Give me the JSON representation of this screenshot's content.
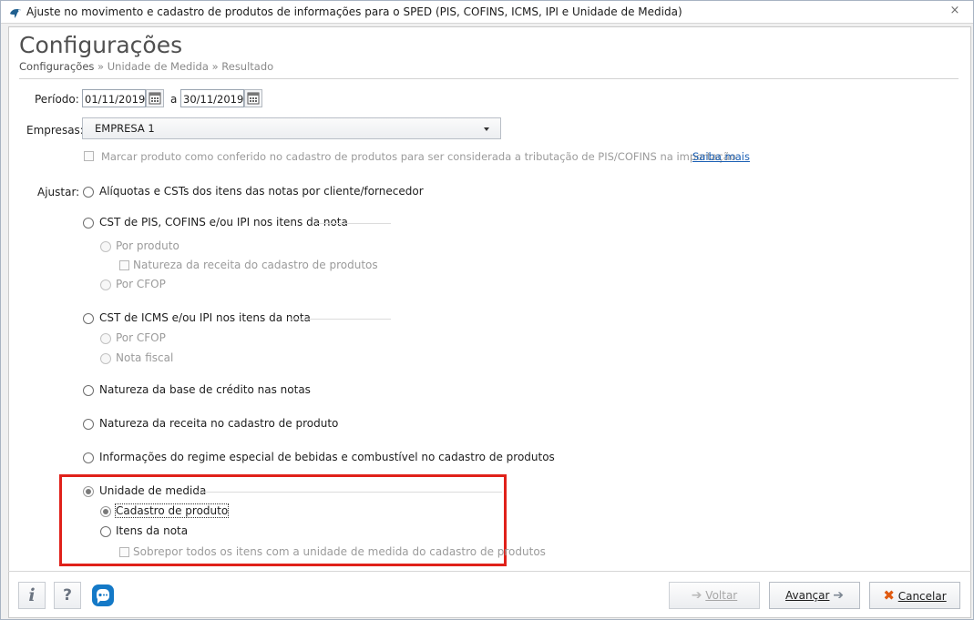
{
  "window": {
    "title": "Ajuste no movimento e cadastro de produtos de informações para o SPED (PIS, COFINS, ICMS, IPI e Unidade de Medida)",
    "close_glyph": "×"
  },
  "header": {
    "title": "Configurações",
    "breadcrumb": [
      "Configurações",
      "Unidade de Medida",
      "Resultado"
    ],
    "separator": "»"
  },
  "form": {
    "periodo_label": "Período:",
    "date_from": "01/11/2019",
    "date_sep": "a",
    "date_to": "30/11/2019",
    "empresas_label": "Empresas:",
    "empresa_selected": "EMPRESA 1",
    "conferido_checkbox": "Marcar produto como conferido no cadastro de produtos para ser considerada a tributação de PIS/COFINS na importação",
    "saiba_mais": "Saiba mais",
    "ajustar_label": "Ajustar:"
  },
  "options": {
    "aliquotas": "Alíquotas e CSTs dos itens das notas por cliente/fornecedor",
    "cst_pis": "CST de PIS, COFINS e/ou IPI nos itens da nota",
    "cst_pis_por_produto": "Por produto",
    "cst_pis_natureza": "Natureza da receita do cadastro de produtos",
    "cst_pis_por_cfop": "Por CFOP",
    "cst_icms": "CST de ICMS e/ou IPI nos itens da nota",
    "cst_icms_por_cfop": "Por CFOP",
    "cst_icms_nota_fiscal": "Nota fiscal",
    "natureza_base": "Natureza da base de crédito nas notas",
    "natureza_receita": "Natureza da receita no cadastro de produto",
    "regime_especial": "Informações do regime especial de bebidas e combustível no cadastro de produtos",
    "unidade_medida": "Unidade de medida",
    "cadastro_produto": "Cadastro de produto",
    "itens_nota": "Itens da nota",
    "sobrepor": "Sobrepor todos os itens com a unidade de medida do cadastro de produtos"
  },
  "footer": {
    "info_glyph": "i",
    "help_glyph": "?",
    "voltar": "Voltar",
    "avancar": "Avançar",
    "cancelar": "Cancelar"
  },
  "colors": {
    "highlight": "#e0211a",
    "link": "#1a5fb4"
  }
}
